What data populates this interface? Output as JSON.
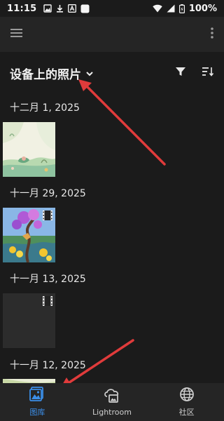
{
  "status_bar": {
    "time": "11:15",
    "battery": "100%",
    "left_icons": [
      "image-icon",
      "download-icon",
      "a-box-icon",
      "white-square-icon"
    ],
    "right_icons": [
      "wifi-icon",
      "signal-icon",
      "battery-icon"
    ]
  },
  "app_bar": {
    "menu_icon": "hamburger-menu-icon",
    "more_icon": "vertical-dots-icon"
  },
  "folder": {
    "title": "设备上的照片",
    "caret_icon": "chevron-down-icon",
    "filter_icon": "filter-icon",
    "sort_icon": "sort-icon"
  },
  "groups": [
    {
      "date": "十二月 1, 2025",
      "items": [
        {
          "kind": "photo"
        }
      ]
    },
    {
      "date": "十一月 29, 2025",
      "items": [
        {
          "kind": "video"
        }
      ]
    },
    {
      "date": "十一月 13, 2025",
      "items": [
        {
          "kind": "video"
        }
      ]
    },
    {
      "date": "十一月 12, 2025",
      "items": [
        {
          "kind": "photo"
        }
      ]
    }
  ],
  "bottom_nav": {
    "items": [
      {
        "label": "图库",
        "icon": "library-icon",
        "active": true
      },
      {
        "label": "Lightroom",
        "icon": "cloud-image-icon",
        "active": false
      },
      {
        "label": "社区",
        "icon": "globe-icon",
        "active": false
      }
    ]
  },
  "colors": {
    "background": "#1b1b1b",
    "bar": "#252525",
    "accent": "#3b8ee8",
    "annotation_arrow": "#e03b3b"
  }
}
